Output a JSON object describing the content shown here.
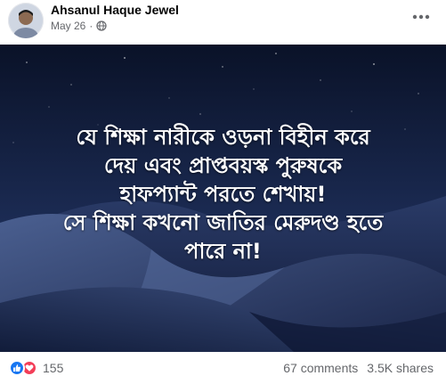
{
  "post": {
    "author": "Ahsanul Haque Jewel",
    "date": "May 26",
    "separator": "·",
    "privacy_icon": "globe-icon",
    "more_icon": "more-horizontal-icon"
  },
  "image": {
    "caption_lines": [
      "যে শিক্ষা নারীকে ওড়না বিহীন করে",
      "দেয় এবং প্রাপ্তবয়স্ক পুরুষকে",
      "হাফপ্যান্ট পরতে শেখায়!",
      "সে শিক্ষা কখনো জাতির মেরুদণ্ড হতে",
      "পারে না!"
    ],
    "background_colors": {
      "sky_top": "#0a1228",
      "sky_bottom": "#1c2c55",
      "dune_light": "#4a5f90",
      "dune_dark": "#111c3a"
    }
  },
  "footer": {
    "reaction_icons": [
      "like-icon",
      "love-icon"
    ],
    "reaction_count": "155",
    "comments": "67 comments",
    "shares": "3.5K shares"
  },
  "colors": {
    "like": "#1877f2",
    "love": "#f33e58",
    "muted_text": "#65676b"
  }
}
